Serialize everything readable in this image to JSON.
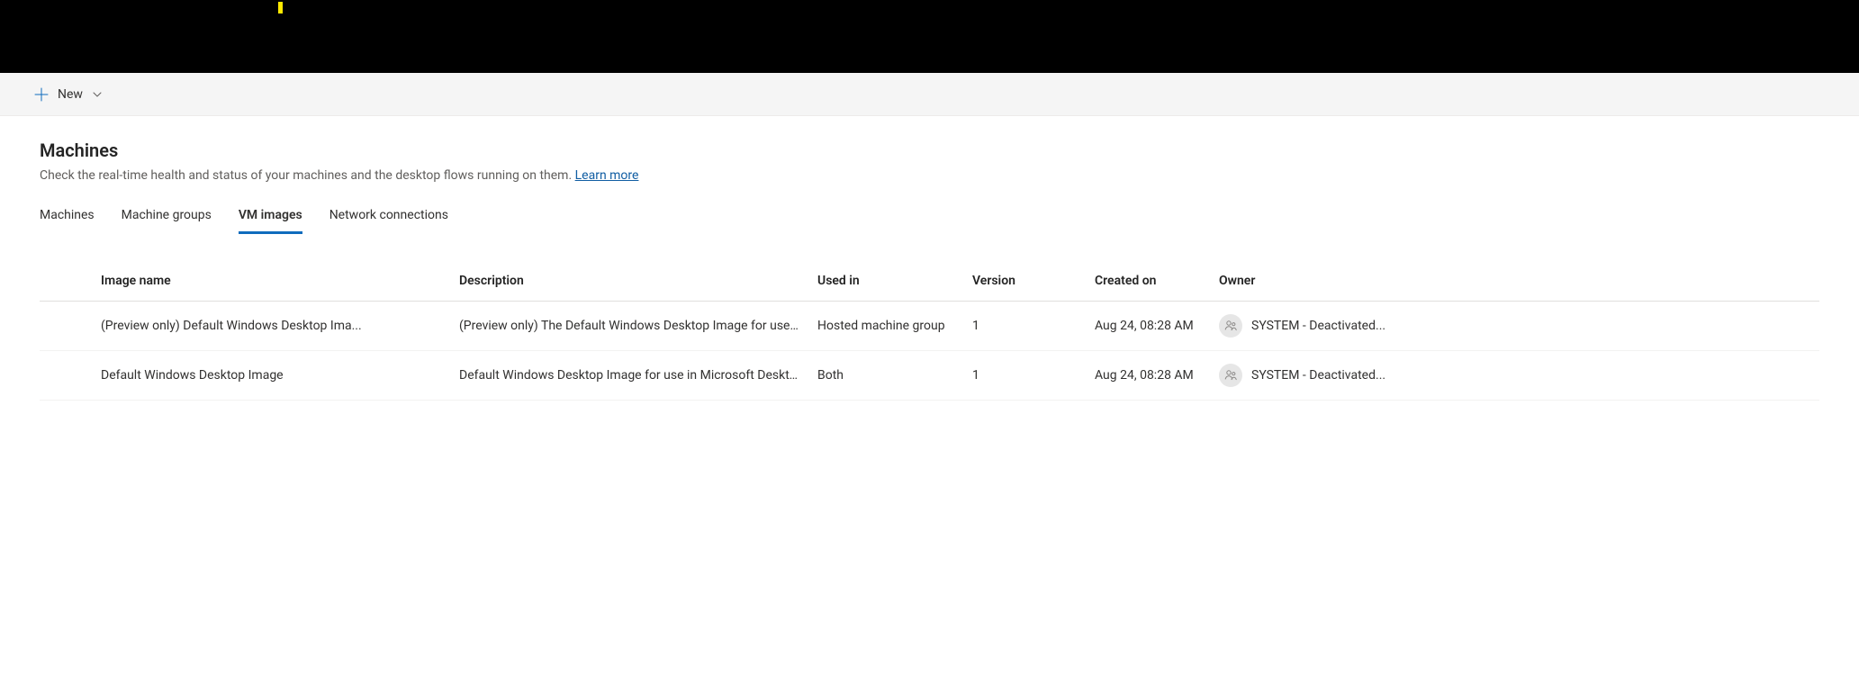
{
  "commandbar": {
    "new_label": "New"
  },
  "page": {
    "title": "Machines",
    "description_prefix": "Check the real-time health and status of your machines and the desktop flows running on them. ",
    "learn_more": "Learn more"
  },
  "tabs": [
    {
      "label": "Machines",
      "active": false
    },
    {
      "label": "Machine groups",
      "active": false
    },
    {
      "label": "VM images",
      "active": true
    },
    {
      "label": "Network connections",
      "active": false
    }
  ],
  "table": {
    "headers": {
      "image_name": "Image name",
      "description": "Description",
      "used_in": "Used in",
      "version": "Version",
      "created_on": "Created on",
      "owner": "Owner"
    },
    "rows": [
      {
        "image_name": "(Preview only) Default Windows Desktop Ima...",
        "description": "(Preview only) The Default Windows Desktop Image for use i...",
        "used_in": "Hosted machine group",
        "version": "1",
        "created_on": "Aug 24, 08:28 AM",
        "owner": "SYSTEM - Deactivated..."
      },
      {
        "image_name": "Default Windows Desktop Image",
        "description": "Default Windows Desktop Image for use in Microsoft Deskto...",
        "used_in": "Both",
        "version": "1",
        "created_on": "Aug 24, 08:28 AM",
        "owner": "SYSTEM - Deactivated..."
      }
    ]
  }
}
